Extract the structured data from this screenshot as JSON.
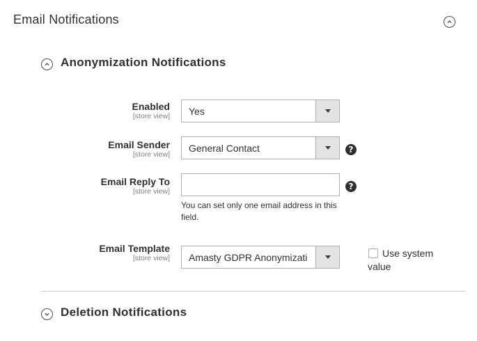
{
  "section": {
    "title": "Email Notifications",
    "toggle_icon": "chevron-up-circle-icon"
  },
  "anonymization": {
    "title": "Anonymization Notifications",
    "toggle_icon": "chevron-up-circle-icon",
    "fields": {
      "enabled": {
        "label": "Enabled",
        "scope": "[store view]",
        "value": "Yes"
      },
      "email_sender": {
        "label": "Email Sender",
        "scope": "[store view]",
        "value": "General Contact",
        "help": "?"
      },
      "email_reply_to": {
        "label": "Email Reply To",
        "scope": "[store view]",
        "value": "",
        "help": "?",
        "note": "You can set only one email address in this field."
      },
      "email_template": {
        "label": "Email Template",
        "scope": "[store view]",
        "value": "Amasty GDPR Anonymizati",
        "use_system_label": "Use system value",
        "use_system_checked": false
      }
    }
  },
  "deletion": {
    "title": "Deletion Notifications",
    "toggle_icon": "chevron-down-circle-icon"
  }
}
